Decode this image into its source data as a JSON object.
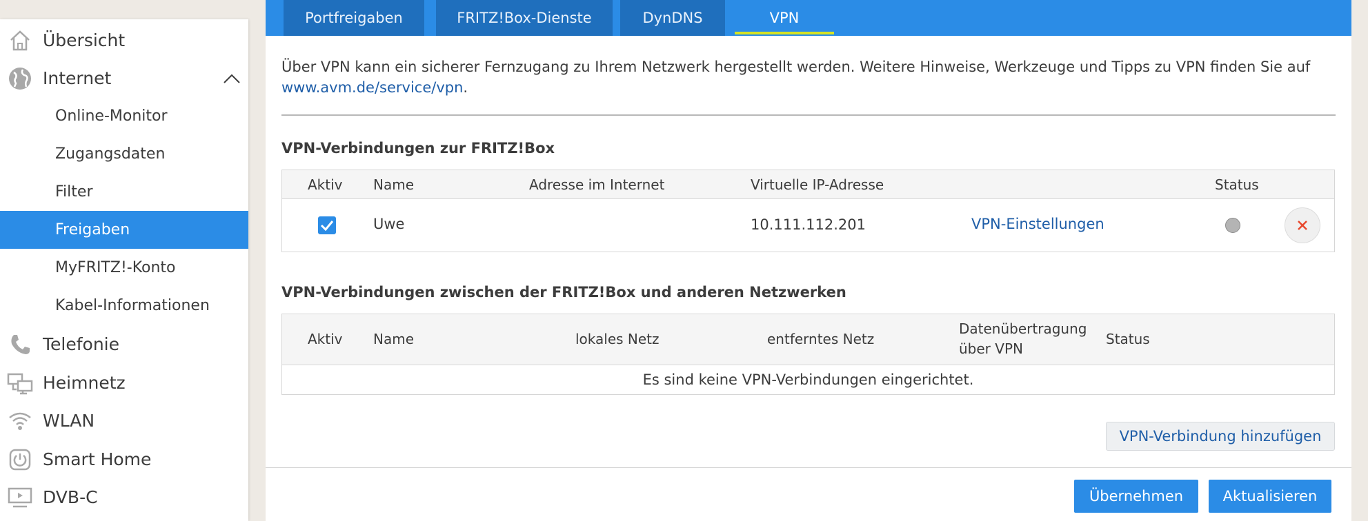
{
  "sidebar": {
    "items": [
      {
        "label": "Übersicht",
        "icon": "home-icon"
      },
      {
        "label": "Internet",
        "icon": "globe-icon",
        "expanded": true
      },
      {
        "label": "Online-Monitor"
      },
      {
        "label": "Zugangsdaten"
      },
      {
        "label": "Filter"
      },
      {
        "label": "Freigaben",
        "active": true
      },
      {
        "label": "MyFRITZ!-Konto"
      },
      {
        "label": "Kabel-Informationen"
      },
      {
        "label": "Telefonie",
        "icon": "phone-icon"
      },
      {
        "label": "Heimnetz",
        "icon": "network-icon"
      },
      {
        "label": "WLAN",
        "icon": "wifi-icon"
      },
      {
        "label": "Smart Home",
        "icon": "power-icon"
      },
      {
        "label": "DVB-C",
        "icon": "tv-icon"
      }
    ]
  },
  "tabs": [
    {
      "label": "Portfreigaben"
    },
    {
      "label": "FRITZ!Box-Dienste"
    },
    {
      "label": "DynDNS"
    },
    {
      "label": "VPN",
      "active": true
    }
  ],
  "intro": {
    "text": "Über VPN kann ein sicherer Fernzugang zu Ihrem Netzwerk hergestellt werden. Weitere Hinweise, Werkzeuge und Tipps zu VPN finden Sie auf",
    "link": "www.avm.de/service/vpn",
    "suffix": "."
  },
  "section1": {
    "title": "VPN-Verbindungen zur FRITZ!Box",
    "headers": {
      "aktiv": "Aktiv",
      "name": "Name",
      "address": "Adresse im Internet",
      "virtual_ip": "Virtuelle IP-Adresse",
      "status": "Status"
    },
    "rows": [
      {
        "aktiv": true,
        "name": "Uwe",
        "address": "",
        "virtual_ip": "10.111.112.201",
        "settings_link": "VPN-Einstellungen",
        "status": "inactive"
      }
    ]
  },
  "section2": {
    "title": "VPN-Verbindungen zwischen der FRITZ!Box und anderen Netzwerken",
    "headers": {
      "aktiv": "Aktiv",
      "name": "Name",
      "local": "lokales Netz",
      "remote": "entferntes Netz",
      "transfer_line1": "Datenübertragung",
      "transfer_line2": "über VPN",
      "status": "Status"
    },
    "empty": "Es sind keine VPN-Verbindungen eingerichtet."
  },
  "buttons": {
    "add": "VPN-Verbindung hinzufügen",
    "apply": "Übernehmen",
    "refresh": "Aktualisieren"
  },
  "colors": {
    "accent": "#2b8ce6",
    "tab_dark": "#1f6fbd",
    "tab_indicator": "#d6e324",
    "link": "#1f5ea8",
    "delete": "#e8472c"
  }
}
